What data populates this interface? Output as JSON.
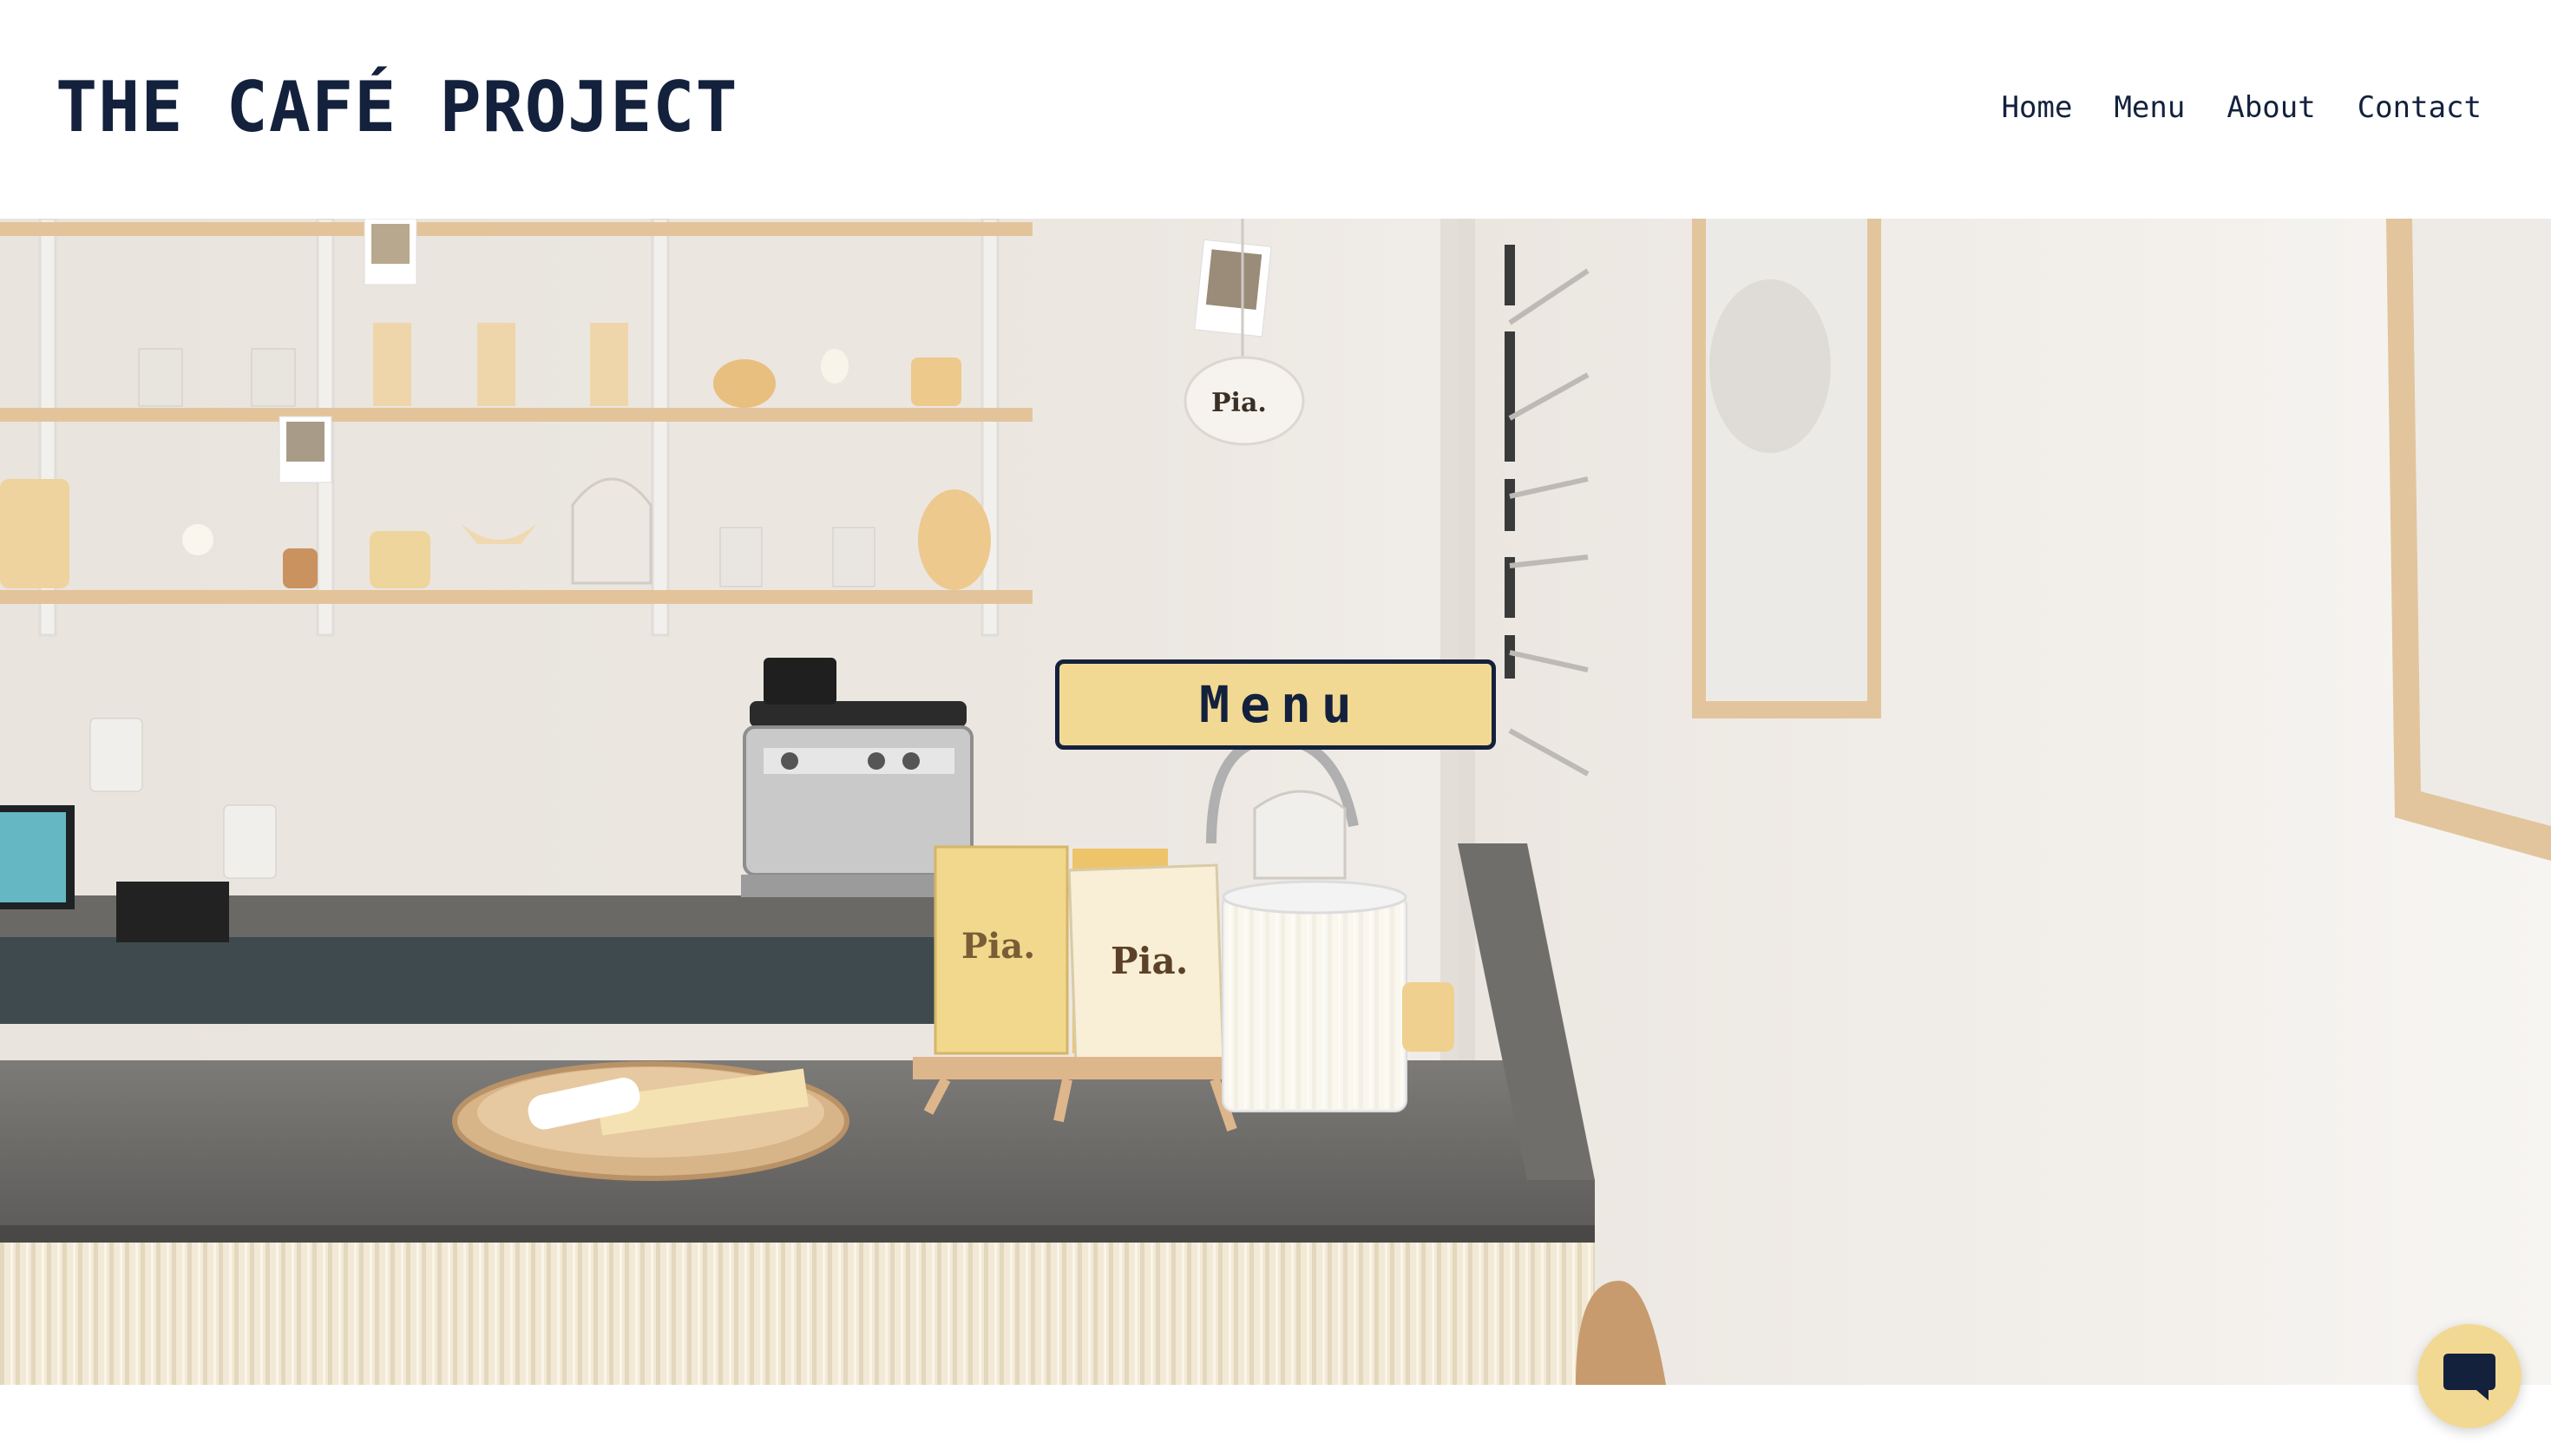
{
  "site": {
    "title": "THE CAFÉ PROJECT"
  },
  "nav": {
    "items": [
      {
        "label": "Home"
      },
      {
        "label": "Menu"
      },
      {
        "label": "About"
      },
      {
        "label": "Contact"
      }
    ]
  },
  "hero": {
    "button_label": "Menu",
    "brand_marks": [
      "Pia.",
      "Pia.",
      "Pia."
    ]
  },
  "chat": {
    "icon": "chat-bubble-icon"
  },
  "colors": {
    "text": "#13213d",
    "accent": "#f2d993",
    "background": "#ffffff"
  }
}
